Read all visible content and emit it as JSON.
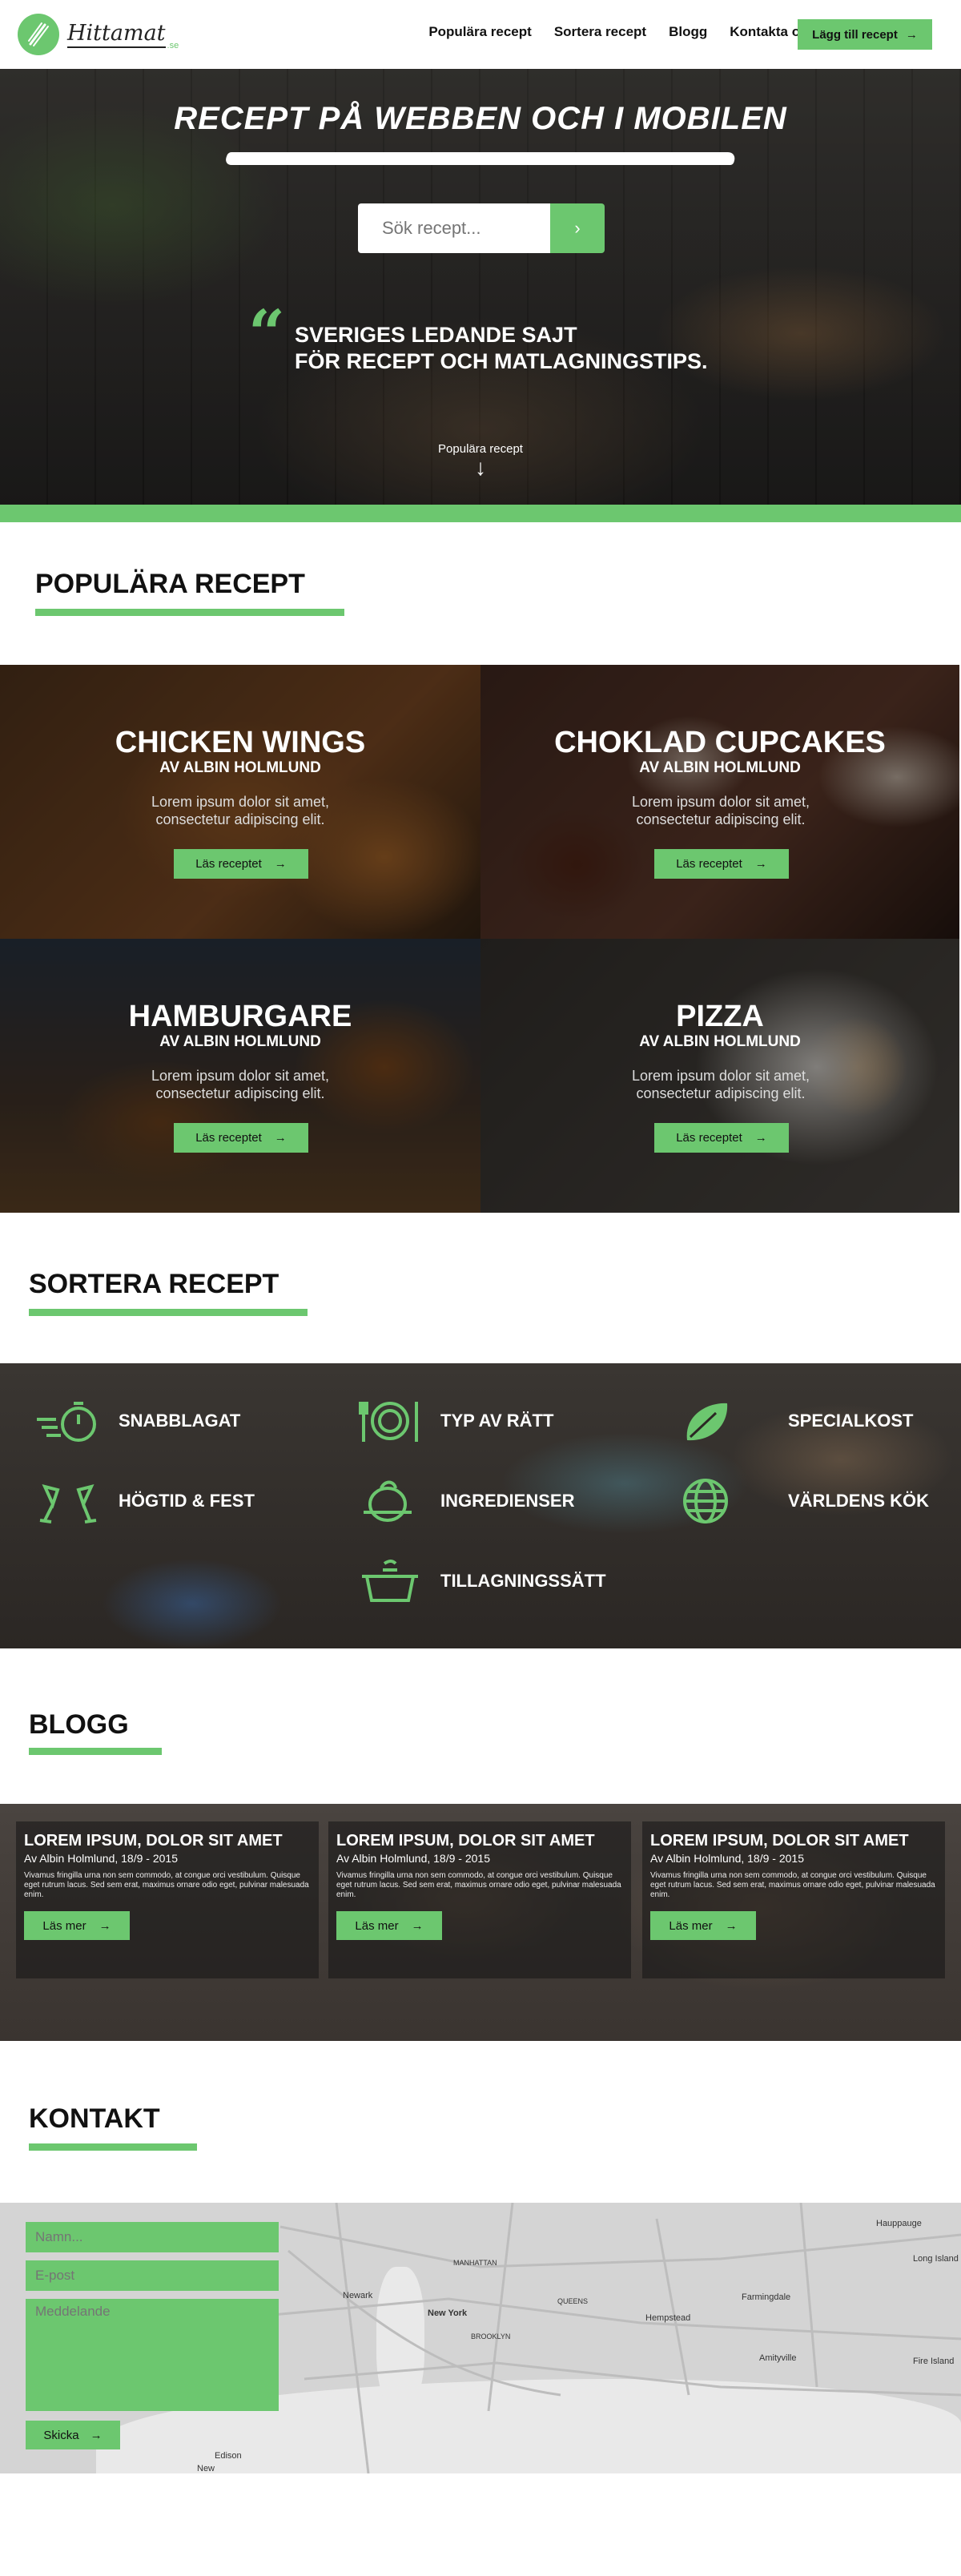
{
  "brand": {
    "name": "Hittamat",
    "suffix": ".se",
    "accent": "#6cc76f"
  },
  "nav": {
    "links": [
      "Populära recept",
      "Sortera recept",
      "Blogg",
      "Kontakta oss"
    ],
    "cta_label": "Lägg till recept"
  },
  "hero": {
    "title": "RECEPT PÅ WEBBEN OCH I MOBILEN",
    "search_placeholder": "Sök recept...",
    "search_button_icon": "chevron-right-icon",
    "tagline_line1": "SVERIGES LEDANDE SAJT",
    "tagline_line2": "FÖR RECEPT OCH MATLAGNINGSTIPS.",
    "scroll_label": "Populära recept"
  },
  "popular": {
    "heading": "POPULÄRA RECEPT",
    "cards": [
      {
        "title": "CHICKEN WINGS",
        "author": "AV ALBIN HOLMLUND",
        "desc": "Lorem ipsum dolor sit amet, consectetur adipiscing elit.",
        "button": "Läs receptet"
      },
      {
        "title": "CHOKLAD CUPCAKES",
        "author": "AV ALBIN HOLMLUND",
        "desc": "Lorem ipsum dolor sit amet, consectetur adipiscing elit.",
        "button": "Läs receptet"
      },
      {
        "title": "HAMBURGARE",
        "author": "AV ALBIN HOLMLUND",
        "desc": "Lorem ipsum dolor sit amet, consectetur adipiscing elit.",
        "button": "Läs receptet"
      },
      {
        "title": "PIZZA",
        "author": "AV ALBIN HOLMLUND",
        "desc": "Lorem ipsum dolor sit amet, consectetur adipiscing elit.",
        "button": "Läs receptet"
      }
    ]
  },
  "sort": {
    "heading": "SORTERA RECEPT",
    "categories": [
      {
        "label": "SNABBLAGAT",
        "icon": "stopwatch-icon"
      },
      {
        "label": "TYP AV RÄTT",
        "icon": "plate-cutlery-icon"
      },
      {
        "label": "SPECIALKOST",
        "icon": "leaf-icon"
      },
      {
        "label": "HÖGTID & FEST",
        "icon": "champagne-glasses-icon"
      },
      {
        "label": "INGREDIENSER",
        "icon": "vegetables-icon"
      },
      {
        "label": "VÄRLDENS KÖK",
        "icon": "globe-icon"
      },
      {
        "label": "TILLAGNINGSSÄTT",
        "icon": "cooking-pot-icon"
      }
    ]
  },
  "blog": {
    "heading": "BLOGG",
    "posts": [
      {
        "title": "LOREM IPSUM, DOLOR SIT AMET",
        "meta": "Av Albin Holmlund, 18/9 - 2015",
        "text": "Vivamus fringilla urna non sem commodo, at congue orci vestibulum. Quisque eget rutrum lacus. Sed sem erat, maximus ornare odio eget, pulvinar malesuada enim.",
        "button": "Läs mer"
      },
      {
        "title": "LOREM IPSUM, DOLOR SIT AMET",
        "meta": "Av Albin Holmlund, 18/9 - 2015",
        "text": "Vivamus fringilla urna non sem commodo, at congue orci vestibulum. Quisque eget rutrum lacus. Sed sem erat, maximus ornare odio eget, pulvinar malesuada enim.",
        "button": "Läs mer"
      },
      {
        "title": "LOREM IPSUM, DOLOR SIT AMET",
        "meta": "Av Albin Holmlund, 18/9 - 2015",
        "text": "Vivamus fringilla urna non sem commodo, at congue orci vestibulum. Quisque eget rutrum lacus. Sed sem erat, maximus ornare odio eget, pulvinar malesuada enim.",
        "button": "Läs mer"
      }
    ]
  },
  "contact": {
    "heading": "KONTAKT",
    "name_placeholder": "Namn...",
    "email_placeholder": "E-post",
    "message_placeholder": "Meddelande",
    "send_label": "Skicka",
    "map_labels": [
      "Hauppauge",
      "Newark",
      "New York",
      "Hempstead",
      "Farmingdale",
      "Long Island",
      "Amityville",
      "Fire Island",
      "Edison",
      "New",
      "BROOKLYN",
      "QUEENS",
      "MANHATTAN"
    ]
  }
}
